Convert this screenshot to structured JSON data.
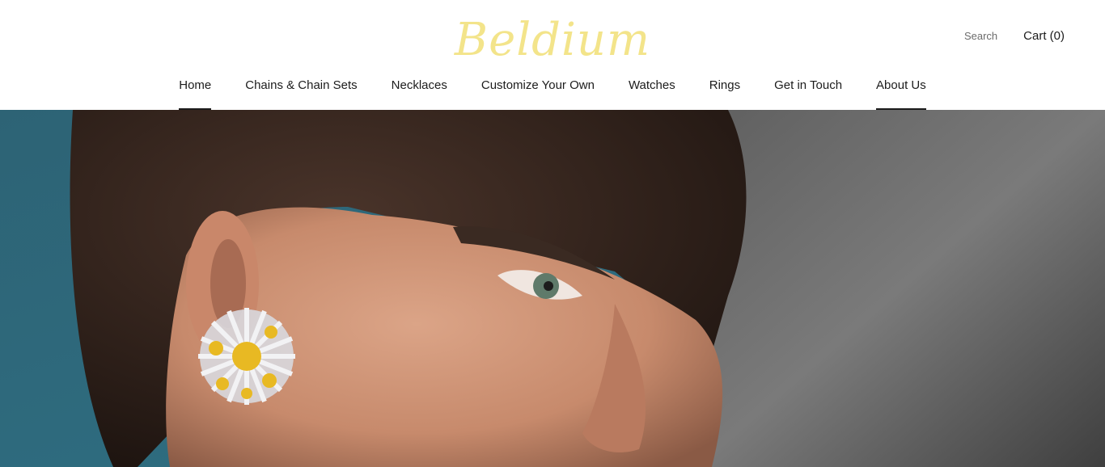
{
  "brand": {
    "name": "Beldium",
    "color": "#f3e48a"
  },
  "header": {
    "search_label": "Search",
    "cart_label": "Cart (0)"
  },
  "nav": {
    "items": [
      {
        "label": "Home",
        "active": true
      },
      {
        "label": "Chains & Chain Sets",
        "active": false
      },
      {
        "label": "Necklaces",
        "active": false
      },
      {
        "label": "Customize Your Own",
        "active": false
      },
      {
        "label": "Watches",
        "active": false
      },
      {
        "label": "Rings",
        "active": false
      },
      {
        "label": "Get in Touch",
        "active": false
      },
      {
        "label": "About Us",
        "active": true
      }
    ]
  },
  "hero": {
    "image_subject": "woman-with-sunburst-earring",
    "colors": {
      "left_background": "#2f6b7e",
      "right_background": "#6f6f6f",
      "hair": "#2a1d17",
      "skin": "#c98d6f",
      "earring_gold": "#e8b923",
      "earring_silver": "#e6e6ea"
    }
  }
}
